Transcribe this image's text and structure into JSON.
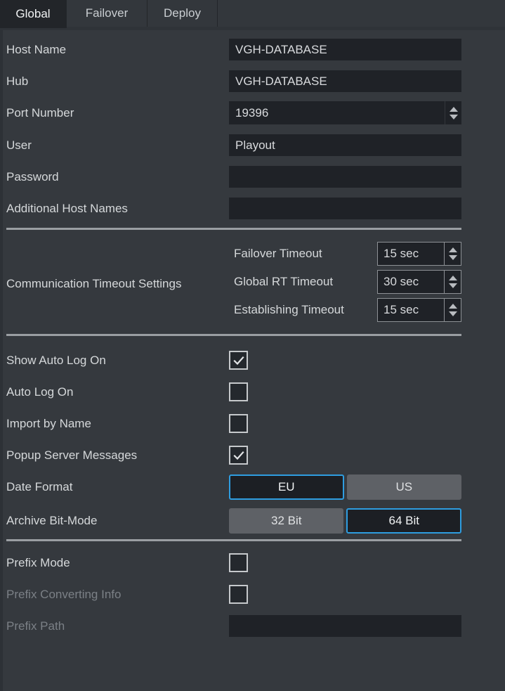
{
  "tabs": [
    {
      "label": "Global",
      "active": true
    },
    {
      "label": "Failover",
      "active": false
    },
    {
      "label": "Deploy",
      "active": false
    }
  ],
  "fields": {
    "host_name": {
      "label": "Host Name",
      "value": "VGH-DATABASE",
      "placeholder": ""
    },
    "hub": {
      "label": "Hub",
      "value": "VGH-DATABASE",
      "placeholder": ""
    },
    "port_number": {
      "label": "Port Number",
      "value": "19396",
      "placeholder": ""
    },
    "user": {
      "label": "User",
      "value": "Playout",
      "placeholder": ""
    },
    "password": {
      "label": "Password",
      "value": "",
      "placeholder": ""
    },
    "additional_host_names": {
      "label": "Additional Host Names",
      "value": "",
      "placeholder": ""
    }
  },
  "timeouts": {
    "group_label": "Communication Timeout Settings",
    "items": [
      {
        "name": "Failover Timeout",
        "value": "15 sec"
      },
      {
        "name": "Global RT Timeout",
        "value": "30 sec"
      },
      {
        "name": "Establishing Timeout",
        "value": "15 sec"
      }
    ]
  },
  "checkboxes": [
    {
      "label": "Show Auto Log On",
      "checked": true,
      "disabled": false
    },
    {
      "label": "Auto Log On",
      "checked": false,
      "disabled": false
    },
    {
      "label": "Import by Name",
      "checked": false,
      "disabled": false
    },
    {
      "label": "Popup Server Messages",
      "checked": true,
      "disabled": false
    }
  ],
  "date_format": {
    "label": "Date Format",
    "options": [
      {
        "label": "EU",
        "selected": true
      },
      {
        "label": "US",
        "selected": false
      }
    ]
  },
  "archive_bit_mode": {
    "label": "Archive Bit-Mode",
    "options": [
      {
        "label": "32 Bit",
        "selected": false
      },
      {
        "label": "64 Bit",
        "selected": true
      }
    ]
  },
  "prefix": {
    "mode": {
      "label": "Prefix Mode",
      "checked": false,
      "disabled": false
    },
    "converting_info": {
      "label": "Prefix Converting Info",
      "checked": false,
      "disabled": true
    },
    "path": {
      "label": "Prefix Path",
      "value": "",
      "placeholder": "",
      "disabled": true
    }
  },
  "colors": {
    "background": "#35393e",
    "field_background": "#1f2227",
    "label_text": "#d5d8da",
    "disabled_text": "#7b8086",
    "accent_selected": "#2e9de0",
    "separator": "#9a9ea2",
    "tab_active_background": "#222529"
  }
}
